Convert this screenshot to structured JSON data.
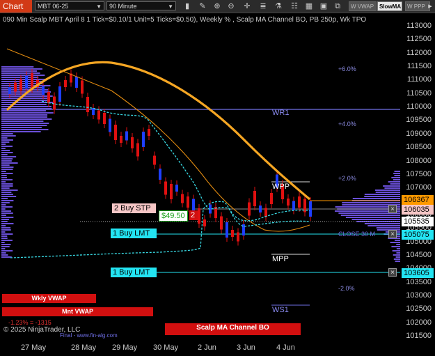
{
  "toolbar": {
    "tab_label": "Chart",
    "instrument": "MBT 06-25",
    "interval": "90 Minute",
    "buttons": {
      "w_vwap": "W VWAP",
      "slow_ma": "SlowMA",
      "w_ppp": "W PPP"
    },
    "icons": [
      "bar-chart-icon",
      "pencil-icon",
      "zoom-in-icon",
      "zoom-out-icon",
      "crosshair-icon",
      "list-icon",
      "strategy-icon",
      "ladder-icon",
      "grid-icon",
      "window-icon",
      "screenshot-icon",
      "arrow-right-icon"
    ]
  },
  "title": "090 Min Scalp MBT April 8 1 Tick=$0.10/1 Unit=5 Ticks=$0.50), Weekly % , Scalp MA Channel BO, PB 250p, Wk TPO",
  "y_axis": [
    "113000",
    "112500",
    "112000",
    "111500",
    "111000",
    "110500",
    "110000",
    "109500",
    "109000",
    "108500",
    "108000",
    "107500",
    "107000",
    "106500",
    "106000",
    "105500",
    "105000",
    "104500",
    "104000",
    "103500",
    "103000",
    "102500",
    "102000",
    "101500"
  ],
  "x_axis": [
    "27 May",
    "28 May",
    "29 May",
    "30 May",
    "2 Jun",
    "3 Jun",
    "4 Jun"
  ],
  "price_tags": {
    "last_high": "106367",
    "stop": "106035",
    "current": "105535",
    "buy1": "105075",
    "buy2": "103605"
  },
  "orders": {
    "stop_label": "2 Buy STP",
    "pnl": "$49.50",
    "qty": "2",
    "buy1_label": "1 Buy LMT",
    "buy2_label": "1 Buy LMT"
  },
  "levels": {
    "wr1": "WR1",
    "wpp": "WPP",
    "mpp": "MPP",
    "ws1": "WS1",
    "close": "CLOSE 30 M"
  },
  "percent_labels": [
    "+6.0%",
    "+4.0%",
    "+2.0%",
    "-2.0%"
  ],
  "bars": {
    "wkly_vwap": "Wkly VWAP",
    "mnt_vwap": "Mnt VWAP",
    "scalp_bo": "Scalp MA Channel BO"
  },
  "footer": {
    "pnl": "-1.23% = -1315",
    "copyright": "© 2025 NinjaTrader, LLC",
    "site": "Final - www.fin-alg.com"
  },
  "colors": {
    "accent": "#d23a16",
    "up_candle": "#1e3fff",
    "down_candle": "#e01010",
    "slow_ma": "#f5a623",
    "fast_ma": "#e08a10",
    "channel": "#38d6e0",
    "profile": "#6a4fd8",
    "tag_cyan": "#23e4f2",
    "tag_pink": "#f6c6c6"
  }
}
